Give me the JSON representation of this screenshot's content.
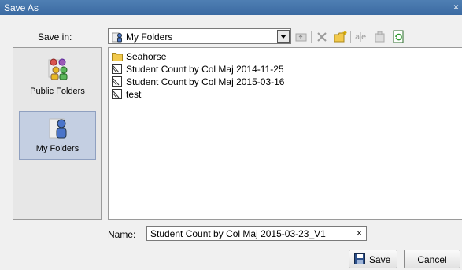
{
  "window": {
    "title": "Save As",
    "close_glyph": "×"
  },
  "save_in": {
    "label": "Save in:",
    "selected": "My Folders",
    "icon": "my-folders-icon"
  },
  "toolbar": [
    {
      "name": "up-one-level-icon",
      "interactable": true
    },
    {
      "name": "delete-icon",
      "interactable": true
    },
    {
      "name": "new-folder-icon",
      "interactable": true
    },
    {
      "name": "rename-icon",
      "interactable": true
    },
    {
      "name": "properties-icon",
      "interactable": true
    },
    {
      "name": "refresh-icon",
      "interactable": true
    }
  ],
  "places": [
    {
      "label": "Public Folders",
      "icon": "public-folders-icon",
      "selected": false
    },
    {
      "label": "My Folders",
      "icon": "my-folders-icon",
      "selected": true
    }
  ],
  "files": [
    {
      "name": "Seahorse",
      "type": "folder",
      "icon": "folder-icon"
    },
    {
      "name": "Student Count by Col Maj 2014-11-25",
      "type": "report",
      "icon": "report-icon"
    },
    {
      "name": "Student Count by Col Maj 2015-03-16",
      "type": "report",
      "icon": "report-icon"
    },
    {
      "name": "test",
      "type": "report",
      "icon": "report-icon"
    }
  ],
  "name_field": {
    "label": "Name:",
    "value": "Student Count by Col Maj 2015-03-23_V1",
    "clear_glyph": "×"
  },
  "buttons": {
    "save": "Save",
    "cancel": "Cancel"
  },
  "colors": {
    "titlebar": "#3b6aa2",
    "selection": "#c4cfe2",
    "folder": "#f2c94c"
  }
}
